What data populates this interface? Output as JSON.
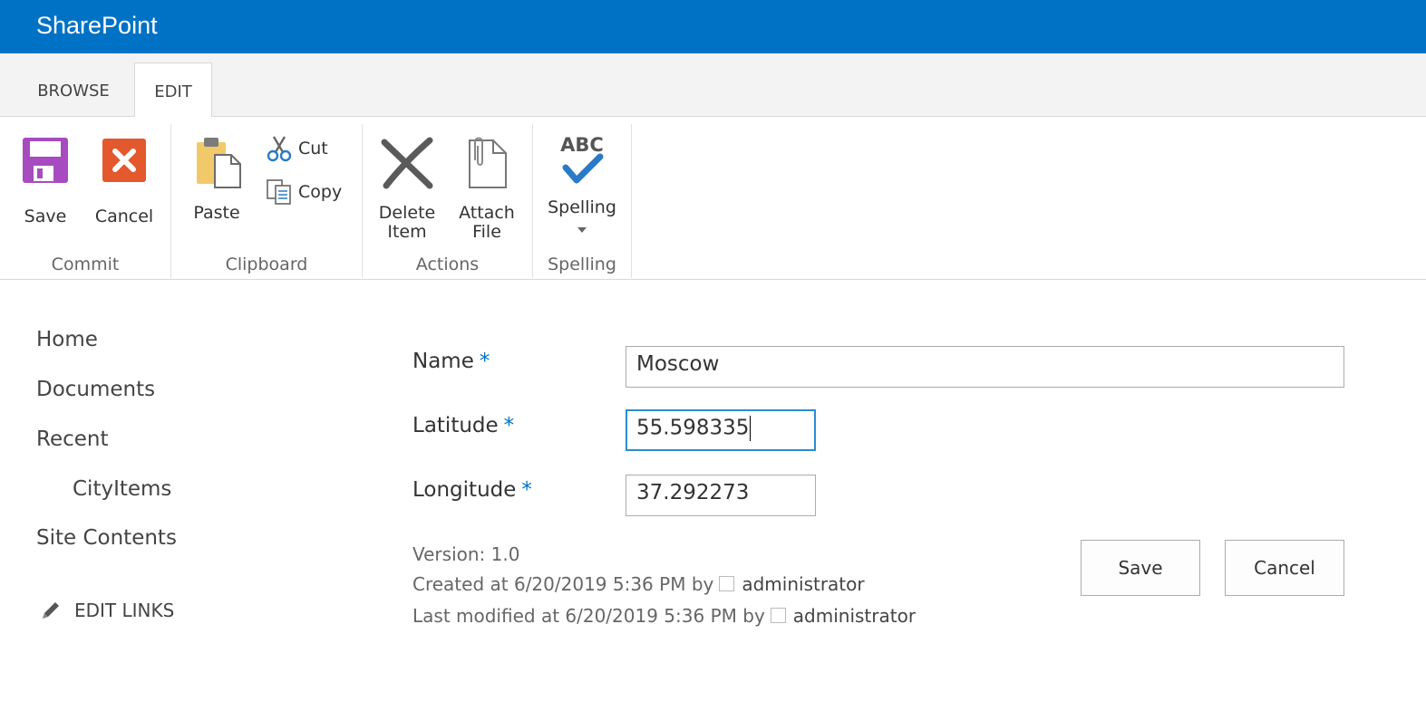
{
  "brand": "SharePoint",
  "tabs": [
    {
      "label": "BROWSE"
    },
    {
      "label": "EDIT"
    }
  ],
  "ribbon": {
    "commit": {
      "title": "Commit",
      "save": "Save",
      "cancel": "Cancel"
    },
    "clipboard": {
      "title": "Clipboard",
      "paste": "Paste",
      "cut": "Cut",
      "copy": "Copy"
    },
    "actions": {
      "title": "Actions",
      "delete_line1": "Delete",
      "delete_line2": "Item",
      "attach_line1": "Attach",
      "attach_line2": "File"
    },
    "spelling": {
      "title": "Spelling",
      "button": "Spelling",
      "icon_text": "ABC"
    }
  },
  "nav": {
    "items": [
      "Home",
      "Documents",
      "Recent",
      "CityItems",
      "Site Contents"
    ],
    "edit_links": "EDIT LINKS"
  },
  "form": {
    "required_marker": "*",
    "name": {
      "label": "Name",
      "value": "Moscow"
    },
    "latitude": {
      "label": "Latitude",
      "value": "55.598335"
    },
    "longitude": {
      "label": "Longitude",
      "value": "37.292273"
    },
    "version": "Version: 1.0",
    "created": {
      "prefix": "Created at 6/20/2019 5:36 PM  by",
      "user": "administrator"
    },
    "modified": {
      "prefix": "Last modified at 6/20/2019 5:36 PM  by",
      "user": "administrator"
    },
    "save": "Save",
    "cancel": "Cancel"
  },
  "colors": {
    "suite_bar": "#0072c6",
    "save_icon": "#a64cc0",
    "cancel_icon": "#e3582d",
    "spell_check": "#2a7ac7",
    "focus_border": "#2a8dd4"
  },
  "icons": [
    "save-icon",
    "cancel-icon",
    "paste-icon",
    "cut-icon",
    "copy-icon",
    "delete-icon",
    "attach-icon",
    "spelling-icon",
    "dropdown-arrow-icon",
    "pencil-icon",
    "presence-icon"
  ]
}
